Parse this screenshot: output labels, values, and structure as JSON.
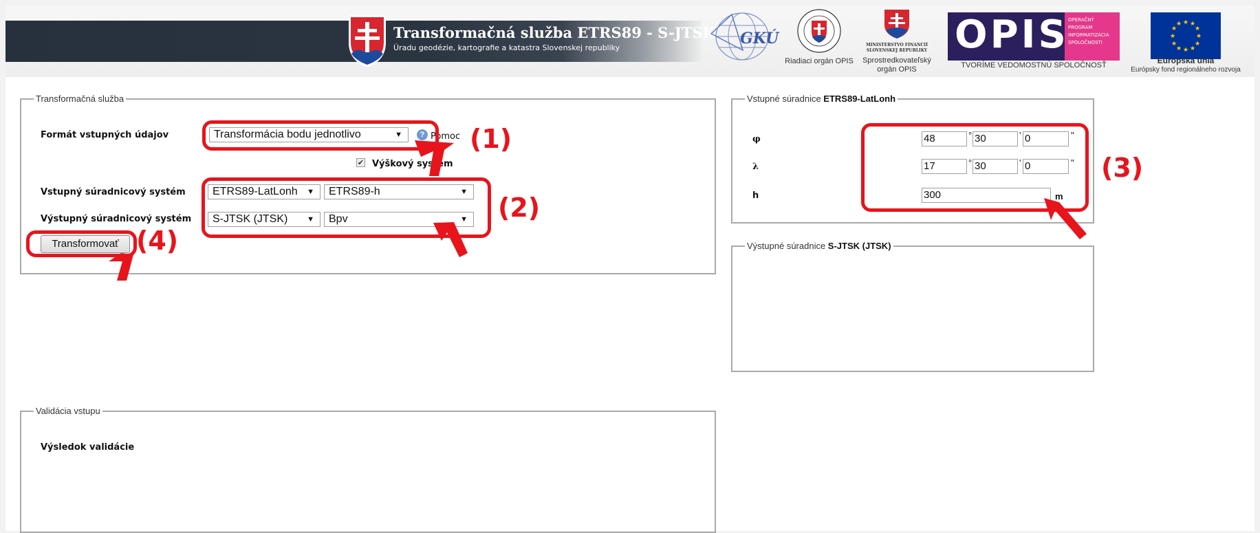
{
  "header": {
    "title": "Transformačná služba ETRS89 - S-JTSK",
    "subtitle": "Úradu geodézie, kartografie a katastra Slovenskej republiky",
    "logos": {
      "gku_text": "GKÚ",
      "opis_managing": "Riadiaci orgán OPIS",
      "ministry_line1": "MINISTERSTVO FINANCIÍ",
      "ministry_line2": "SLOVENSKEJ REPUBLIKY",
      "ministry_caption1": "Sprostredkovateľský",
      "ministry_caption2": "orgán OPIS",
      "opis_name": "OPIS",
      "opis_side1": "OPERAČNÝ",
      "opis_side2": "PROGRAM",
      "opis_side3": "INFORMATIZÁCIA",
      "opis_side4": "SPOLOČNOSTI",
      "opis_tagline": "TVORÍME VEDOMOSTNÚ SPOLOČNOSŤ",
      "eu_title": "Európska únia",
      "eu_sub": "Európsky fond regionálneho rozvoja"
    }
  },
  "transform_service": {
    "legend": "Transformačná služba",
    "format_label": "Formát vstupných údajov",
    "format_value": "Transformácia bodu jednotlivo",
    "help_label": "Pomoc",
    "height_system_label": "Výškový systém",
    "input_system_label": "Vstupný súradnicový systém",
    "input_system_value": "ETRS89-LatLonh",
    "input_height_value": "ETRS89-h",
    "output_system_label": "Výstupný súradnicový systém",
    "output_system_value": "S-JTSK (JTSK)",
    "output_height_value": "Bpv",
    "transform_button": "Transformovať"
  },
  "input_coords": {
    "legend_prefix": "Vstupné súradnice ",
    "legend_bold": "ETRS89-LatLonh",
    "phi_label": "φ",
    "phi_deg": "48",
    "phi_min": "30",
    "phi_sec": "0",
    "lambda_label": "λ",
    "lambda_deg": "17",
    "lambda_min": "30",
    "lambda_sec": "0",
    "h_label": "h",
    "h_value": "300",
    "deg_unit": "°",
    "min_unit": "'",
    "sec_unit": "\"",
    "h_unit": "m"
  },
  "output_coords": {
    "legend_prefix": "Výstupné súradnice ",
    "legend_bold": "S-JTSK (JTSK)"
  },
  "validation": {
    "legend": "Validácia vstupu",
    "result_label": "Výsledok validácie"
  },
  "annotations": {
    "n1": "(1)",
    "n2": "(2)",
    "n3": "(3)",
    "n4": "(4)",
    "color": "#e8141c"
  }
}
